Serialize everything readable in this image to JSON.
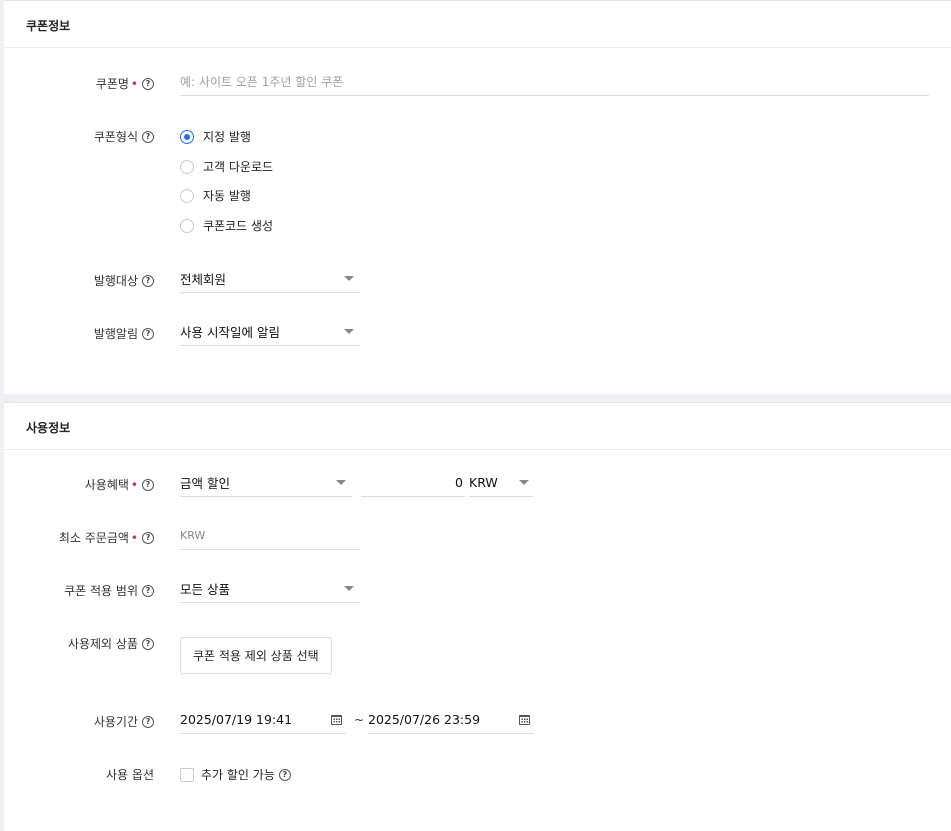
{
  "coupon_info": {
    "title": "쿠폰정보",
    "name": {
      "label": "쿠폰명",
      "required": "•",
      "placeholder": "예: 사이트 오픈 1주년 할인 쿠폰",
      "value": ""
    },
    "type": {
      "label": "쿠폰형식",
      "options": [
        {
          "label": "지정 발행",
          "selected": true
        },
        {
          "label": "고객 다운로드",
          "selected": false
        },
        {
          "label": "자동 발행",
          "selected": false
        },
        {
          "label": "쿠폰코드 생성",
          "selected": false
        }
      ]
    },
    "target": {
      "label": "발행대상",
      "value": "전체회원"
    },
    "notify": {
      "label": "발행알림",
      "value": "사용 시작일에 알림"
    }
  },
  "usage_info": {
    "title": "사용정보",
    "benefit": {
      "label": "사용혜택",
      "required": "•",
      "type_value": "금액 할인",
      "amount": "0",
      "currency": "KRW"
    },
    "min_order": {
      "label": "최소 주문금액",
      "required": "•",
      "unit": "KRW"
    },
    "scope": {
      "label": "쿠폰 적용 범위",
      "value": "모든 상품"
    },
    "exclude": {
      "label": "사용제외 상품",
      "button": "쿠폰 적용 제외 상품 선택"
    },
    "period": {
      "label": "사용기간",
      "start": "2025/07/19 19:41",
      "separator": "~",
      "end": "2025/07/26 23:59"
    },
    "options": {
      "label": "사용 옵션",
      "checkbox_label": "추가 할인 가능",
      "checked": false
    }
  },
  "icons": {
    "help": "question-circle-icon",
    "calendar": "calendar-icon",
    "dropdown": "caret-down-icon"
  },
  "colors": {
    "accent": "#1e6ff5",
    "required": "#e0245e"
  }
}
